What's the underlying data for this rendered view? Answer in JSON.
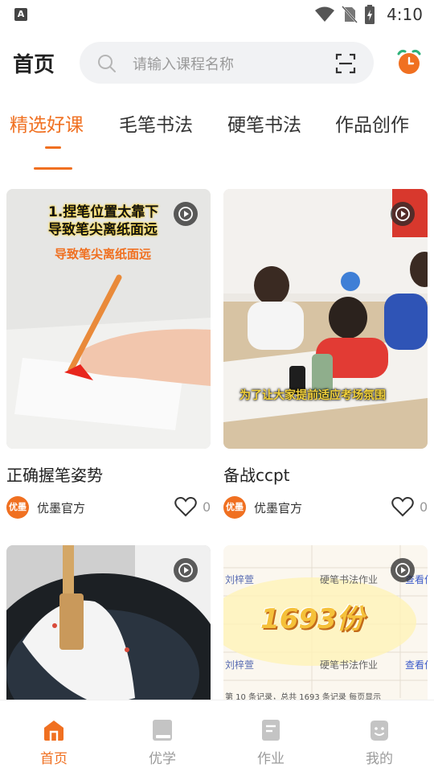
{
  "status_bar": {
    "time": "4:10",
    "badge_letter": "A"
  },
  "header": {
    "title": "首页",
    "search_placeholder": "请输入课程名称"
  },
  "tabs": [
    {
      "label": "精选好课",
      "active": true
    },
    {
      "label": "毛笔书法",
      "active": false
    },
    {
      "label": "硬笔书法",
      "active": false
    },
    {
      "label": "作品创作",
      "active": false
    }
  ],
  "cards": [
    {
      "title": "正确握笔姿势",
      "author": "优墨官方",
      "avatar_text": "优墨",
      "likes": "0",
      "captions": [
        "1.捏笔位置太靠下",
        "导致笔尖离纸面远",
        "导致笔尖离纸面远"
      ]
    },
    {
      "title": "备战ccpt",
      "author": "优墨官方",
      "avatar_text": "优墨",
      "likes": "0",
      "captions": [
        "为了让大家提前适应考场氛围"
      ]
    },
    {
      "title": "",
      "author": "",
      "avatar_text": "",
      "likes": "",
      "captions": []
    },
    {
      "title": "",
      "author": "",
      "avatar_text": "",
      "likes": "",
      "captions": [
        "1693份",
        "刘梓萱",
        "硬笔书法作业",
        "查看作",
        "第 10 条记录，总共 1693 条记录 每页显示",
        "10"
      ]
    }
  ],
  "bottom_nav": [
    {
      "label": "首页",
      "icon": "home-icon",
      "active": true
    },
    {
      "label": "优学",
      "icon": "book-icon",
      "active": false
    },
    {
      "label": "作业",
      "icon": "homework-icon",
      "active": false
    },
    {
      "label": "我的",
      "icon": "profile-icon",
      "active": false
    }
  ],
  "colors": {
    "accent": "#f07021",
    "search_bg": "#f1f2f4",
    "nav_inactive": "#9b9b9b"
  }
}
